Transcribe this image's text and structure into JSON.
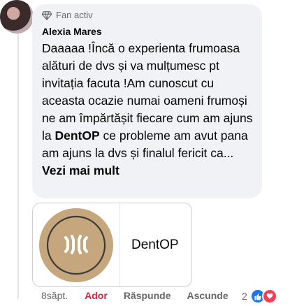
{
  "comment": {
    "badge": "Fan activ",
    "author": "Alexia Mares",
    "text_before": "Daaaaa !Încă o experienta frumoasa alături de dvs și va mulțumesc pt invitația facuta !Am cunoscut cu aceasta ocazie numai oameni frumoși ne am împărtășit fiecare cum am ajuns la ",
    "text_bold": "DentOP",
    "text_after": " ce probleme am avut pana am ajuns la dvs și finalul fericit ca... ",
    "see_more": "Vezi mai mult"
  },
  "link_card": {
    "title": "DentOP"
  },
  "actions": {
    "time": "8săpt.",
    "like": "Ador",
    "reply": "Răspunde",
    "hide": "Ascunde"
  },
  "reactions": {
    "count": "2"
  },
  "colors": {
    "bubble": "#f0f2f5",
    "liked": "#e41e3f",
    "like_blue": "#1877f2",
    "love_red": "#f33e58",
    "logo_bg": "#c6a67d"
  }
}
